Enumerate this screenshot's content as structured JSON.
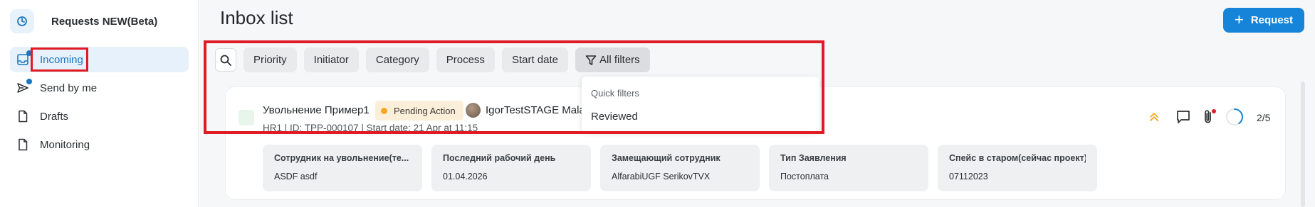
{
  "app": {
    "title": "Requests NEW(Beta)",
    "logo_icon": "refresh-icon"
  },
  "sidebar": {
    "items": [
      {
        "label": "Incoming",
        "icon": "inbox-icon",
        "active": true,
        "unread_dot": true
      },
      {
        "label": "Send by me",
        "icon": "send-icon",
        "active": false,
        "unread_dot": true
      },
      {
        "label": "Drafts",
        "icon": "document-icon",
        "active": false,
        "unread_dot": false
      },
      {
        "label": "Monitoring",
        "icon": "document-icon",
        "active": false,
        "unread_dot": false
      }
    ]
  },
  "header": {
    "title": "Inbox list",
    "request_button": "Request",
    "request_icon": "plus-icon"
  },
  "filters": {
    "search_icon": "search-icon",
    "chips": [
      "Priority",
      "Initiator",
      "Category",
      "Process",
      "Start date"
    ],
    "all_filters": "All filters",
    "all_filters_icon": "funnel-icon",
    "dropdown": {
      "header": "Quick filters",
      "items": [
        "Reviewed"
      ]
    }
  },
  "request": {
    "title": "Увольнение Пример1",
    "status": "Pending Action",
    "initiator": "IgorTestSTAGE Mala",
    "meta": "HR1 |  ID: TPP-000107  | Start date: 21 Apr at 11:15",
    "progress": "2/5",
    "progress_fraction": 0.4,
    "fields": [
      {
        "label": "Сотрудник на увольнение(те...",
        "value": "ASDF asdf"
      },
      {
        "label": "Последний рабочий день",
        "value": "01.04.2026"
      },
      {
        "label": "Замещающий сотрудник",
        "value": "AlfarabiUGF SerikovTVX"
      },
      {
        "label": "Тип Заявления",
        "value": "Постоплата"
      },
      {
        "label": "Спейс в старом(сейчас проект)",
        "value": "07112023"
      }
    ]
  },
  "colors": {
    "accent": "#1684d8",
    "highlight": "#e01b24",
    "status_dot": "#f5a623",
    "priority": "#f5a623"
  }
}
